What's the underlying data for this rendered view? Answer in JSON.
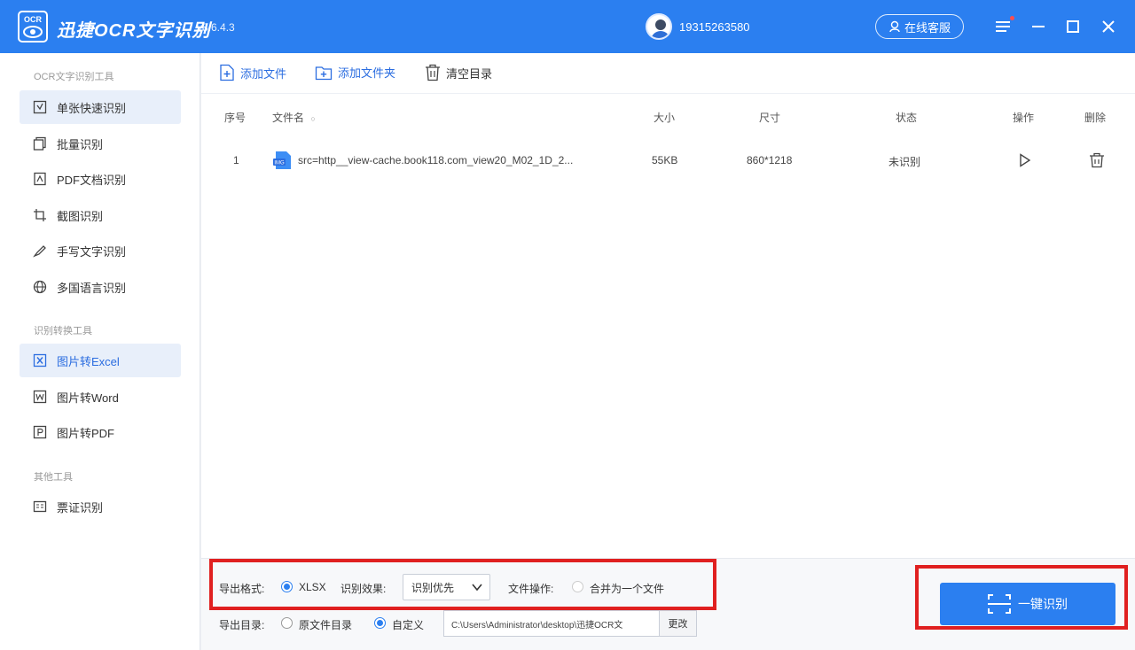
{
  "app": {
    "logo_text": "OCR",
    "title": "迅捷OCR文字识别",
    "version": "v8.6.4.3",
    "user_phone": "19315263580",
    "service_label": "在线客服"
  },
  "sidebar": {
    "group1_title": "OCR文字识别工具",
    "group2_title": "识别转换工具",
    "group3_title": "其他工具",
    "items": [
      {
        "label": "单张快速识别",
        "icon": "single-scan-icon"
      },
      {
        "label": "批量识别",
        "icon": "batch-icon"
      },
      {
        "label": "PDF文档识别",
        "icon": "pdf-doc-icon"
      },
      {
        "label": "截图识别",
        "icon": "screenshot-icon"
      },
      {
        "label": "手写文字识别",
        "icon": "handwriting-icon"
      },
      {
        "label": "多国语言识别",
        "icon": "globe-icon"
      },
      {
        "label": "图片转Excel",
        "icon": "excel-icon"
      },
      {
        "label": "图片转Word",
        "icon": "word-icon"
      },
      {
        "label": "图片转PDF",
        "icon": "pdf-icon"
      },
      {
        "label": "票证识别",
        "icon": "ticket-icon"
      }
    ]
  },
  "toolbar": {
    "add_file": "添加文件",
    "add_folder": "添加文件夹",
    "clear_list": "清空目录"
  },
  "table": {
    "headers": {
      "index": "序号",
      "filename": "文件名",
      "sort_mark": "○",
      "size": "大小",
      "dimensions": "尺寸",
      "status": "状态",
      "action": "操作",
      "delete": "删除"
    },
    "rows": [
      {
        "index": "1",
        "filename": "src=http__view-cache.book118.com_view20_M02_1D_2...",
        "size": "55KB",
        "dimensions": "860*1218",
        "status": "未识别"
      }
    ]
  },
  "options": {
    "format_label": "导出格式:",
    "format_value": "XLSX",
    "effect_label": "识别效果:",
    "effect_value": "识别优先",
    "file_op_label": "文件操作:",
    "merge_label": "合并为一个文件",
    "dir_label": "导出目录:",
    "dir_original": "原文件目录",
    "dir_custom": "自定义",
    "dir_path": "C:\\Users\\Administrator\\desktop\\迅捷OCR文",
    "change_label": "更改"
  },
  "actions": {
    "recognize_label": "一键识别"
  },
  "colors": {
    "brand": "#2b7ff0",
    "active_bg": "#e8effa",
    "highlight": "#e02020"
  }
}
